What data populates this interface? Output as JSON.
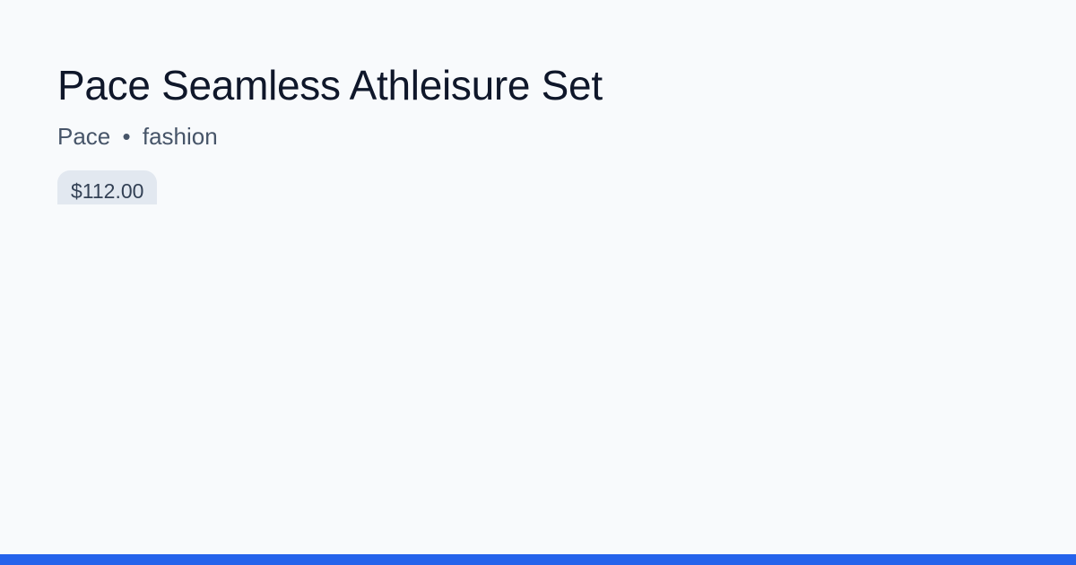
{
  "product": {
    "title": "Pace Seamless Athleisure Set",
    "brand": "Pace",
    "separator": "•",
    "category": "fashion",
    "price": "$112.00"
  },
  "colors": {
    "background": "#f8fafc",
    "title": "#0f172a",
    "meta": "#475569",
    "badge_bg": "#e2e8f0",
    "badge_text": "#334155",
    "accent": "#2563eb"
  }
}
